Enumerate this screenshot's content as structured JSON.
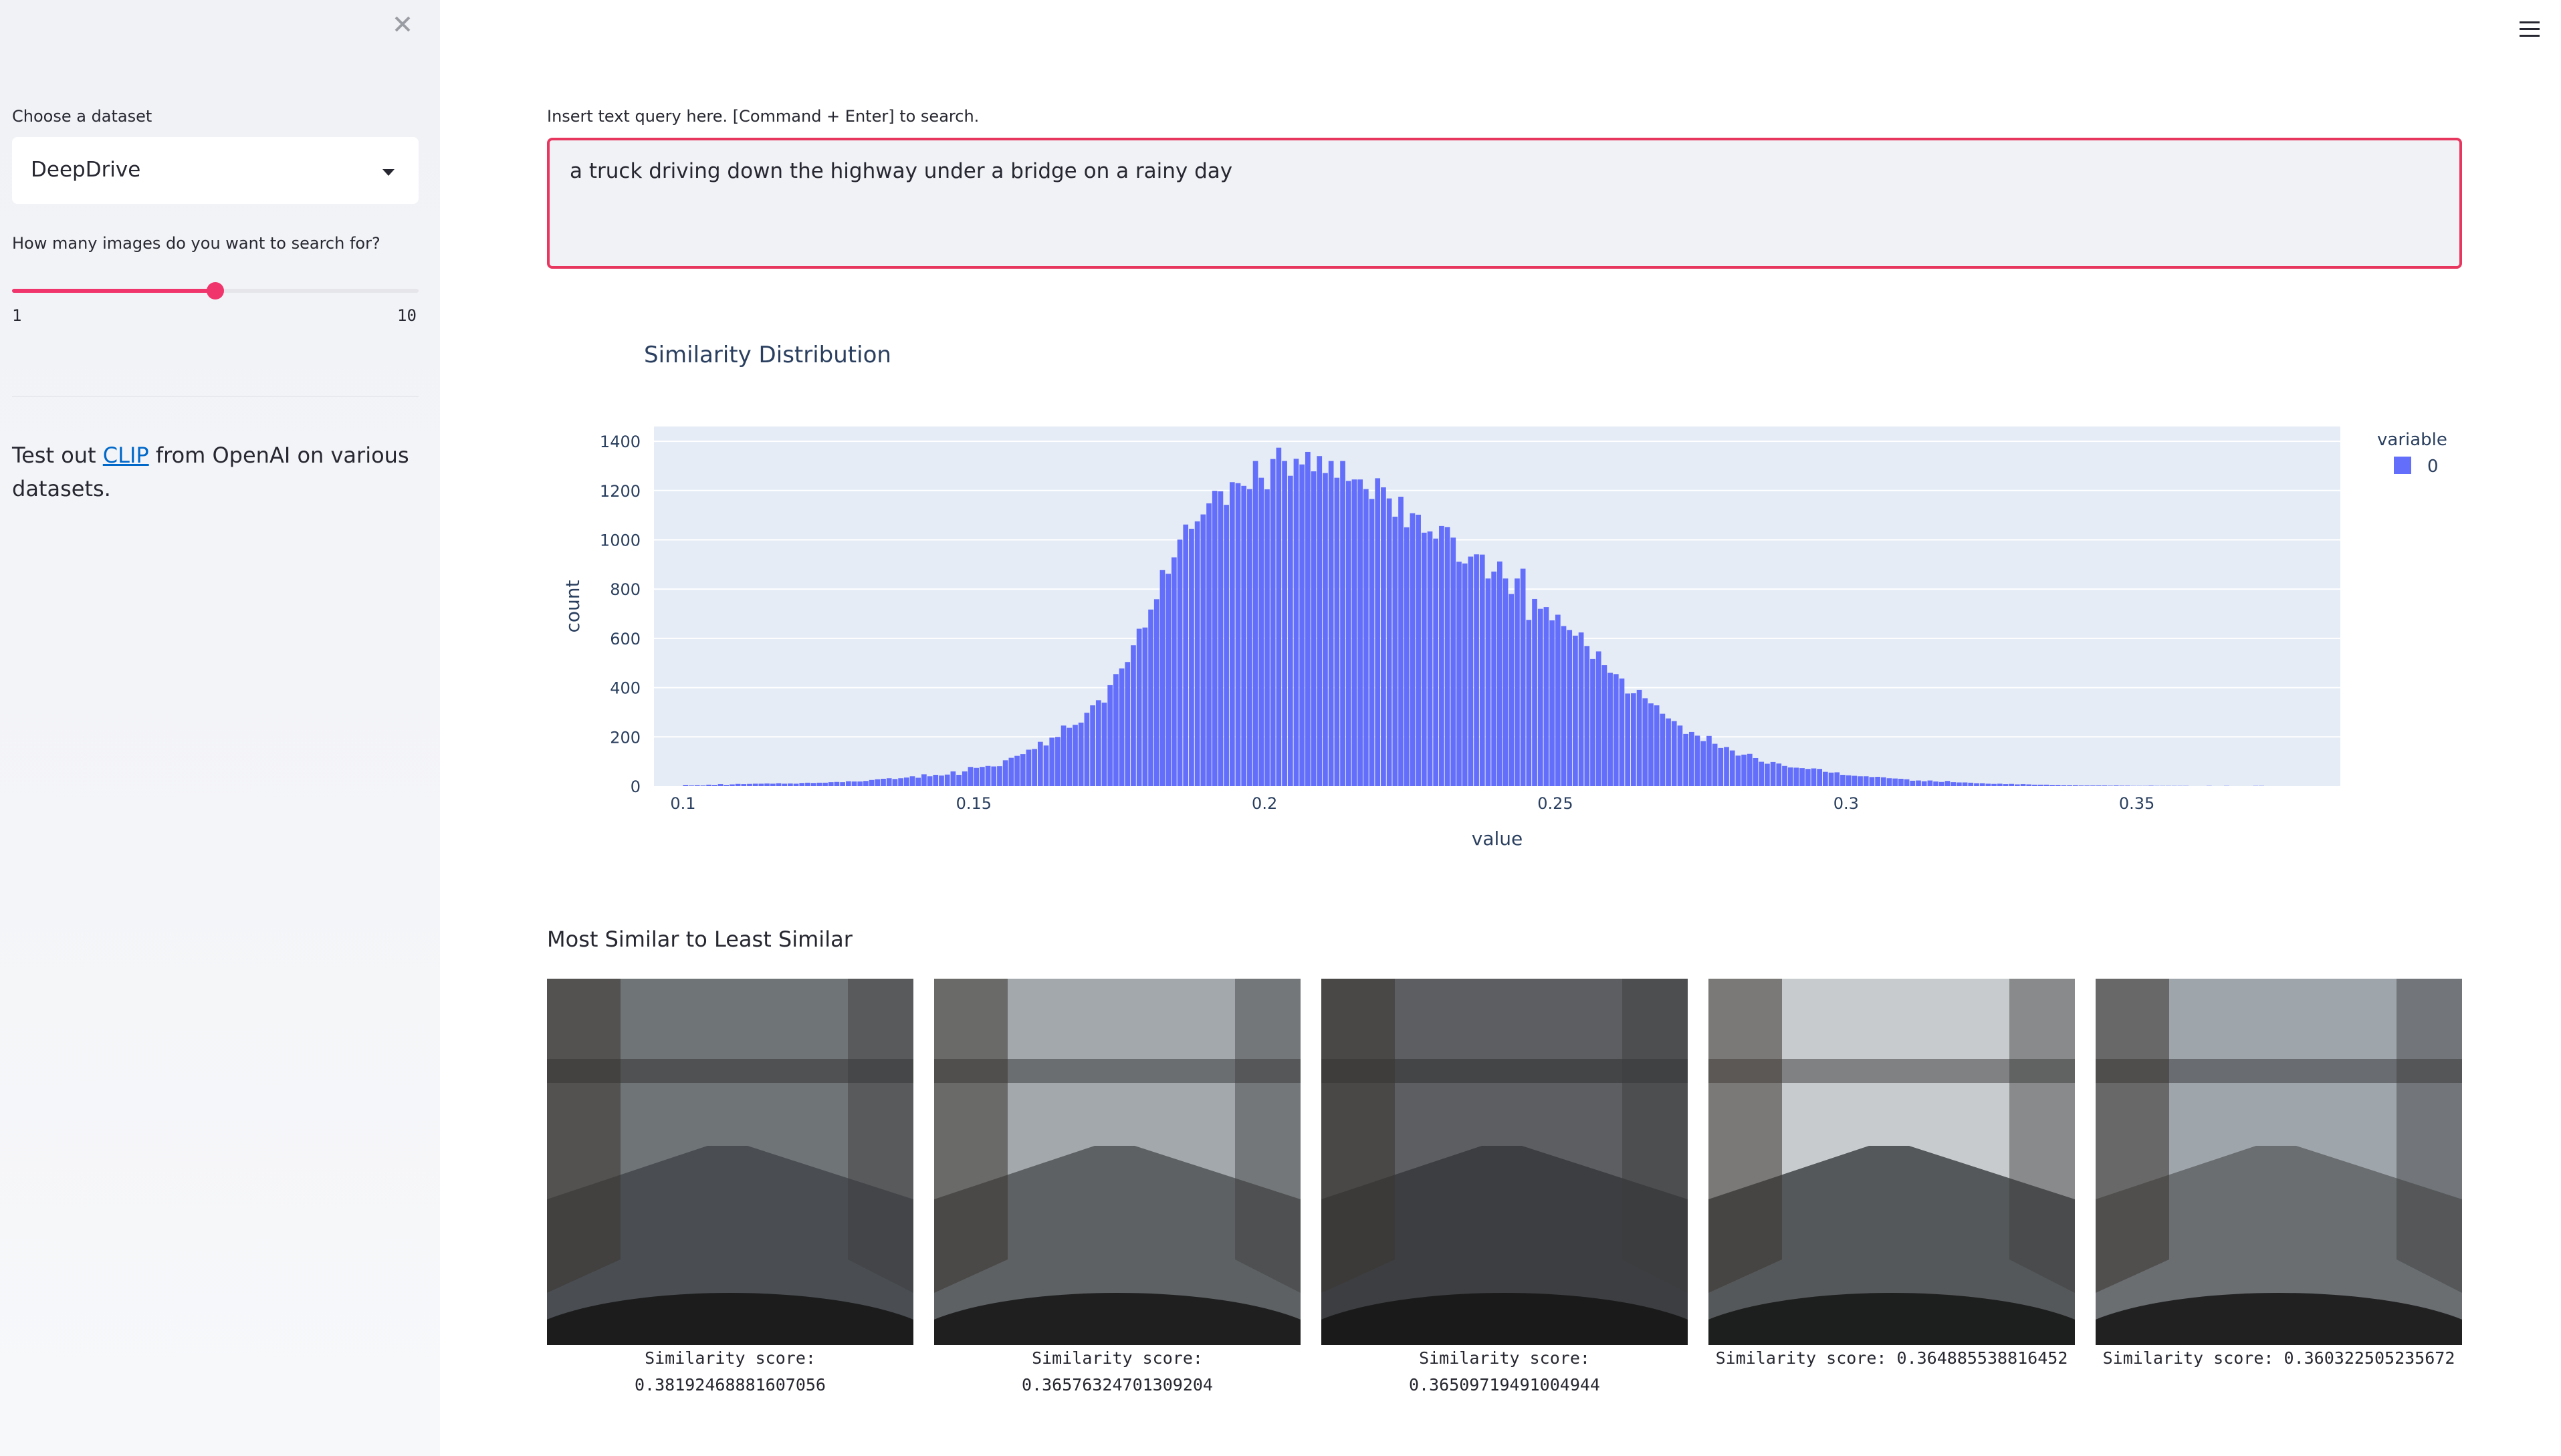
{
  "sidebar": {
    "close_icon": "close-icon",
    "dataset_label": "Choose a dataset",
    "dataset_value": "DeepDrive",
    "count_label": "How many images do you want to search for?",
    "slider": {
      "min_label": "1",
      "max_label": "10",
      "min": 1,
      "max": 10,
      "value": 5.5
    },
    "info_prefix": "Test out ",
    "info_link": "CLIP",
    "info_suffix": " from OpenAI on various datasets."
  },
  "header": {
    "menu_icon": "hamburger-menu-icon"
  },
  "query": {
    "label": "Insert text query here. [Command + Enter] to search.",
    "value": "a truck driving down the highway under a bridge on a rainy day"
  },
  "chart_data": {
    "type": "bar",
    "title": "Similarity Distribution",
    "xlabel": "value",
    "ylabel": "count",
    "xlim": [
      0.095,
      0.385
    ],
    "ylim": [
      0,
      1460
    ],
    "xticks": [
      "0.1",
      "0.15",
      "0.2",
      "0.25",
      "0.3",
      "0.35"
    ],
    "yticks": [
      "0",
      "200",
      "400",
      "600",
      "800",
      "1000",
      "1200",
      "1400"
    ],
    "legend": {
      "title": "variable",
      "entries": [
        "0"
      ],
      "placement": "right"
    },
    "bin_start": 0.1,
    "bin_width": 0.001,
    "values": [
      5,
      3,
      4,
      3,
      6,
      5,
      8,
      5,
      7,
      9,
      8,
      9,
      10,
      10,
      11,
      10,
      12,
      10,
      11,
      10,
      13,
      14,
      13,
      14,
      14,
      16,
      17,
      16,
      20,
      19,
      19,
      21,
      25,
      28,
      30,
      32,
      29,
      32,
      35,
      40,
      34,
      48,
      40,
      46,
      43,
      47,
      60,
      46,
      60,
      78,
      74,
      78,
      82,
      80,
      81,
      105,
      115,
      123,
      130,
      148,
      151,
      180,
      165,
      197,
      200,
      246,
      237,
      249,
      258,
      298,
      328,
      349,
      339,
      410,
      455,
      478,
      504,
      572,
      639,
      644,
      717,
      759,
      877,
      862,
      929,
      1001,
      1062,
      1045,
      1075,
      1103,
      1148,
      1199,
      1197,
      1142,
      1234,
      1230,
      1219,
      1206,
      1320,
      1252,
      1205,
      1328,
      1374,
      1320,
      1260,
      1329,
      1306,
      1357,
      1278,
      1340,
      1271,
      1320,
      1252,
      1320,
      1239,
      1245,
      1245,
      1206,
      1166,
      1250,
      1213,
      1168,
      1094,
      1175,
      1051,
      1108,
      1102,
      1029,
      1034,
      1005,
      1056,
      1052,
      1009,
      911,
      904,
      932,
      941,
      940,
      843,
      871,
      912,
      843,
      780,
      843,
      883,
      675,
      760,
      720,
      727,
      673,
      696,
      650,
      634,
      611,
      624,
      569,
      516,
      547,
      491,
      460,
      455,
      437,
      376,
      377,
      391,
      357,
      336,
      328,
      294,
      275,
      264,
      246,
      212,
      220,
      205,
      183,
      204,
      172,
      155,
      159,
      145,
      124,
      128,
      131,
      114,
      99,
      91,
      98,
      92,
      82,
      76,
      75,
      73,
      70,
      72,
      70,
      58,
      55,
      56,
      46,
      44,
      42,
      40,
      40,
      37,
      38,
      36,
      32,
      31,
      30,
      28,
      22,
      23,
      20,
      23,
      19,
      17,
      21,
      16,
      15,
      15,
      14,
      12,
      12,
      10,
      9,
      10,
      8,
      9,
      7,
      8,
      7,
      6,
      6,
      6,
      5,
      5,
      4,
      4,
      4,
      3,
      3,
      3,
      3,
      3,
      2,
      3,
      2,
      2,
      1,
      1,
      1,
      2,
      1,
      1,
      1,
      1,
      1,
      1,
      0,
      0,
      0,
      1,
      0,
      0,
      1,
      0,
      0,
      0,
      0,
      1,
      1
    ],
    "color": "#636efa"
  },
  "results": {
    "heading": "Most Similar to Least Similar",
    "items": [
      {
        "caption_label": "Similarity score:",
        "caption_value": "0.38192468881607056",
        "sky": "#6f7477",
        "road": "#4a4e52"
      },
      {
        "caption_label": "Similarity score:",
        "caption_value": "0.36576324701309204",
        "sky": "#a2a8ab",
        "road": "#5d6163"
      },
      {
        "caption_label": "Similarity score:",
        "caption_value": "0.36509719491004944",
        "sky": "#5c5e61",
        "road": "#3c3e41"
      },
      {
        "caption_label": "Similarity score: 0.364885538816452",
        "caption_value": "",
        "sky": "#c8cbcd",
        "road": "#55585a"
      },
      {
        "caption_label": "Similarity score: 0.360322505235672",
        "caption_value": "",
        "sky": "#9ea5ab",
        "road": "#6a6e71"
      }
    ]
  }
}
